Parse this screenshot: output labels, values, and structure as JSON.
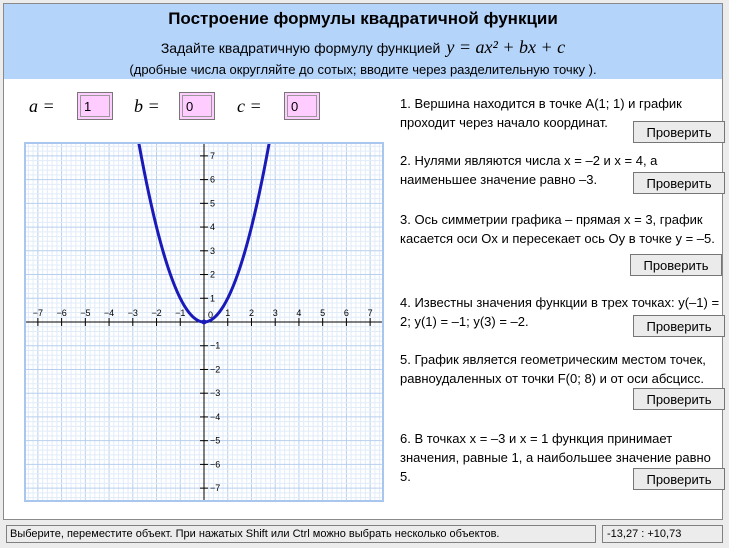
{
  "header": {
    "title": "Построение формулы квадратичной функции",
    "subtitle": "Задайте квадратичную формулу функцией",
    "formula": "y = ax² + bx + c",
    "note": "(дробные числа округляйте до сотых; вводите через разделительную точку ).",
    "bg_color": "#b5d4fa"
  },
  "params": {
    "a": {
      "label": "a =",
      "value": "1"
    },
    "b": {
      "label": "b =",
      "value": "0"
    },
    "c": {
      "label": "c =",
      "value": "0"
    },
    "field_color": "#ffccff"
  },
  "graph": {
    "x_range": [
      -7.5,
      7.5
    ],
    "y_range": [
      -7.5,
      7.5
    ],
    "tick_labels": [
      -7,
      -6,
      -5,
      -4,
      -3,
      -2,
      -1,
      1,
      2,
      3,
      4,
      5,
      6,
      7
    ],
    "origin_label": "0",
    "curve_color": "#1a1ab8",
    "grid_color": "#cfe0f5",
    "border_color": "#a9c7ee"
  },
  "tasks": [
    {
      "text": "1. Вершина находится в точке A(1; 1) и график проходит через начало координат.",
      "button": "Проверить"
    },
    {
      "text": "2. Нулями являются числа x = –2 и x = 4, а наименьшее значение равно –3.",
      "button": "Проверить"
    },
    {
      "text": "3. Ось симметрии графика – прямая x = 3, график касается оси Ox и пересекает ось Oy в точке y = –5.",
      "button": "Проверить"
    },
    {
      "text": "4. Известны значения функции в трех точках: y(–1) = 2; y(1) = –1; y(3) = –2.",
      "button": "Проверить"
    },
    {
      "text": "5. График является геометрическим местом точек, равноудаленных от точки F(0; 8) и от оси абсцисс.",
      "button": "Проверить"
    },
    {
      "text": "6. В точках x = –3 и x = 1 функция принимает значения, равные 1, а наибольшее значение равно 5.",
      "button": "Проверить"
    }
  ],
  "status": {
    "message": "Выберите, переместите объект. При нажатых Shift или Ctrl можно выбрать несколько объектов.",
    "coords": "-13,27 :  +10,73"
  }
}
